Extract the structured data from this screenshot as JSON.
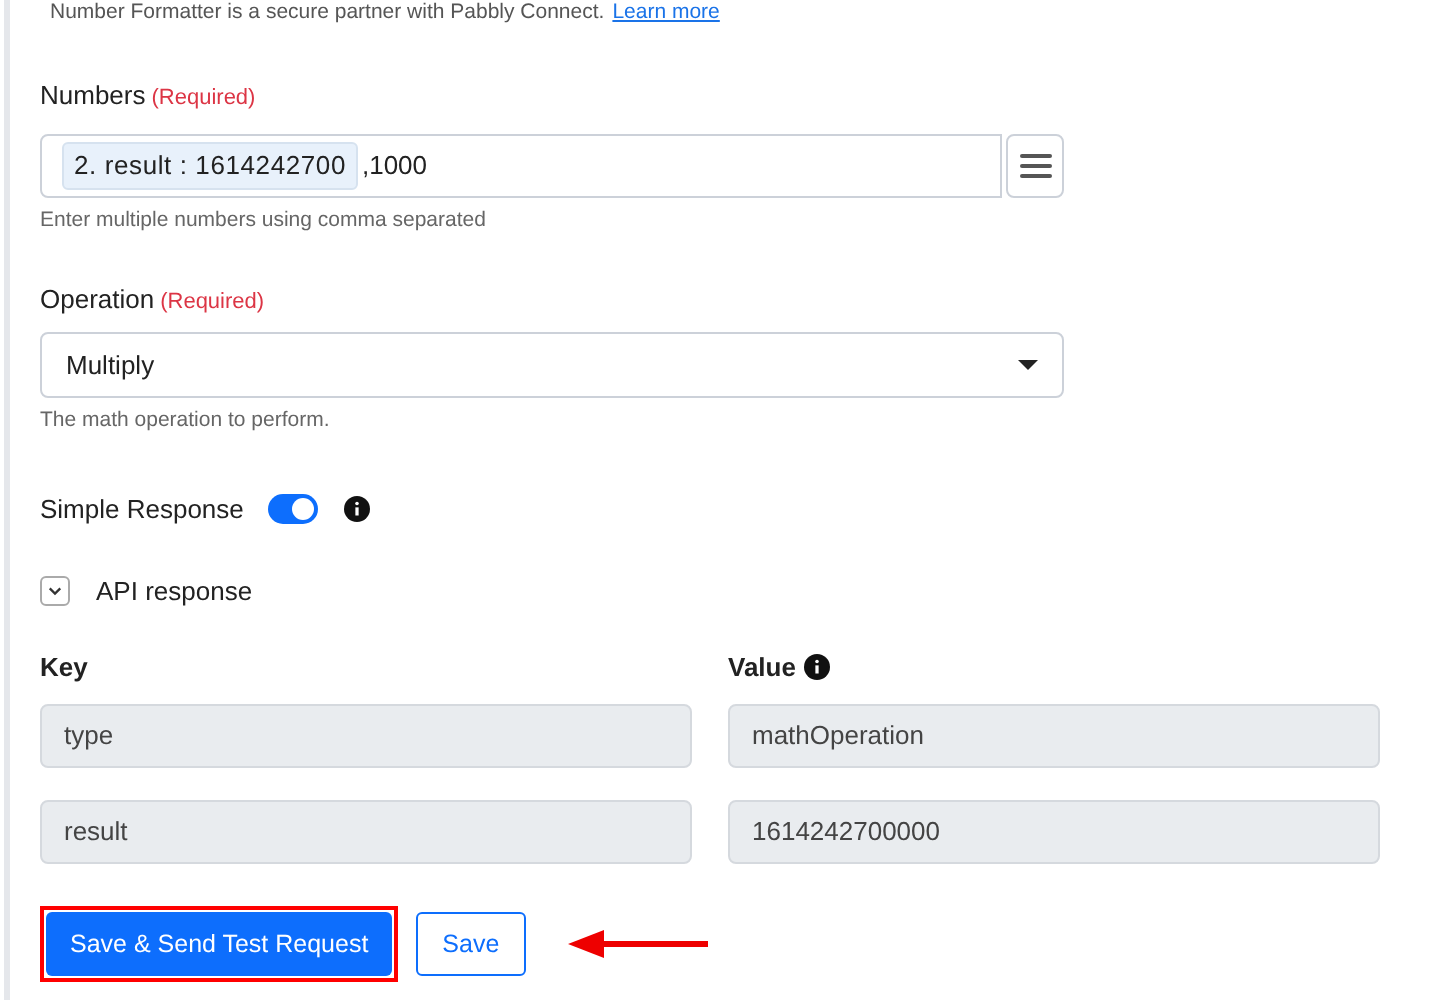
{
  "notice": {
    "text": "Number Formatter is a secure partner with Pabbly Connect.",
    "link": "Learn more"
  },
  "numbers": {
    "label": "Numbers",
    "required": "(Required)",
    "token": "2. result : 1614242700",
    "value": ",1000",
    "help": "Enter multiple numbers using comma separated"
  },
  "operation": {
    "label": "Operation",
    "required": "(Required)",
    "value": "Multiply",
    "help": "The math operation to perform."
  },
  "simple_response": {
    "label": "Simple Response",
    "on": true
  },
  "api_response": {
    "label": "API response",
    "expanded": true
  },
  "table": {
    "columns": [
      "Key",
      "Value"
    ],
    "rows": [
      {
        "key": "type",
        "value": "mathOperation"
      },
      {
        "key": "result",
        "value": "1614242700000"
      }
    ]
  },
  "buttons": {
    "primary": "Save & Send Test Request",
    "secondary": "Save"
  }
}
